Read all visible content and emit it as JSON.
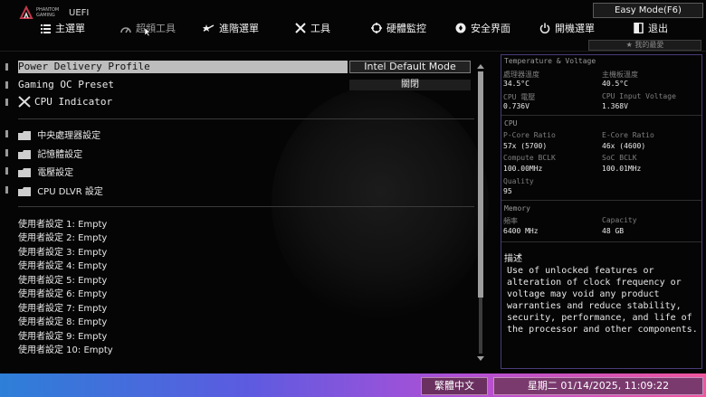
{
  "header": {
    "logo_text_line1": "PHANTOM",
    "logo_text_line2": "GAMING",
    "uefi_label": "UEFI",
    "easy_mode_label": "Easy Mode(F6)",
    "favorites_label": "★ 我的最愛",
    "nav": [
      {
        "label": "主選單",
        "icon": "list-icon"
      },
      {
        "label": "超頻工具",
        "icon": "speedometer-icon",
        "active": true
      },
      {
        "label": "進階選單",
        "icon": "star-arrow-icon"
      },
      {
        "label": "工具",
        "icon": "tools-icon"
      },
      {
        "label": "硬體監控",
        "icon": "monitor-icon"
      },
      {
        "label": "安全界面",
        "icon": "shield-icon"
      },
      {
        "label": "開機選單",
        "icon": "power-icon"
      },
      {
        "label": "退出",
        "icon": "exit-icon"
      }
    ]
  },
  "settings": {
    "power_delivery": {
      "label": "Power Delivery Profile",
      "value": "Intel Default Mode"
    },
    "gaming_oc": {
      "label": "Gaming OC Preset",
      "value": "關閉"
    },
    "cpu_indicator": {
      "label": "CPU Indicator"
    },
    "folders": [
      "中央處理器設定",
      "記憶體設定",
      "電壓設定",
      "CPU DLVR 設定"
    ],
    "user_profiles": [
      "使用者設定 1: Empty",
      "使用者設定 2: Empty",
      "使用者設定 3: Empty",
      "使用者設定 4: Empty",
      "使用者設定 5: Empty",
      "使用者設定 6: Empty",
      "使用者設定 7: Empty",
      "使用者設定 8: Empty",
      "使用者設定 9: Empty",
      "使用者設定 10: Empty"
    ]
  },
  "scroll": {
    "position_fraction": 0,
    "visible_fraction": 0.8
  },
  "monitor": {
    "temp_title": "Temperature & Voltage",
    "cpu_temp_label": "處理器溫度",
    "cpu_temp": "34.5°C",
    "mb_temp_label": "主機板溫度",
    "mb_temp": "40.5°C",
    "cpu_volt_label": "CPU 電壓",
    "cpu_volt": "0.736V",
    "cpu_input_label": "CPU Input Voltage",
    "cpu_input": "1.368V",
    "cpu_title": "CPU",
    "pcore_label": "P-Core Ratio",
    "pcore": "57x (5700)",
    "ecore_label": "E-Core Ratio",
    "ecore": "46x (4600)",
    "compute_bclk_label": "Compute BCLK",
    "compute_bclk": "100.00MHz",
    "soc_bclk_label": "SoC BCLK",
    "soc_bclk": "100.01MHz",
    "quality_label": "Quality",
    "quality": "95",
    "memory_title": "Memory",
    "freq_label": "頻率",
    "freq": "6400 MHz",
    "capacity_label": "Capacity",
    "capacity": "48 GB"
  },
  "description": {
    "title": "描述",
    "text": "Use of unlocked features or alteration of clock frequency or voltage may void any product warranties and reduce stability, security, performance, and life of the processor and other components."
  },
  "footer": {
    "language": "繁體中文",
    "datetime": "星期二 01/14/2025, 11:09:22"
  },
  "colors": {
    "accent_panel_border": "#4a3b7a",
    "selected_row": "#bdbdbd",
    "bottom_gradient_start": "#2d7fd8",
    "bottom_gradient_end": "#f0569c"
  }
}
